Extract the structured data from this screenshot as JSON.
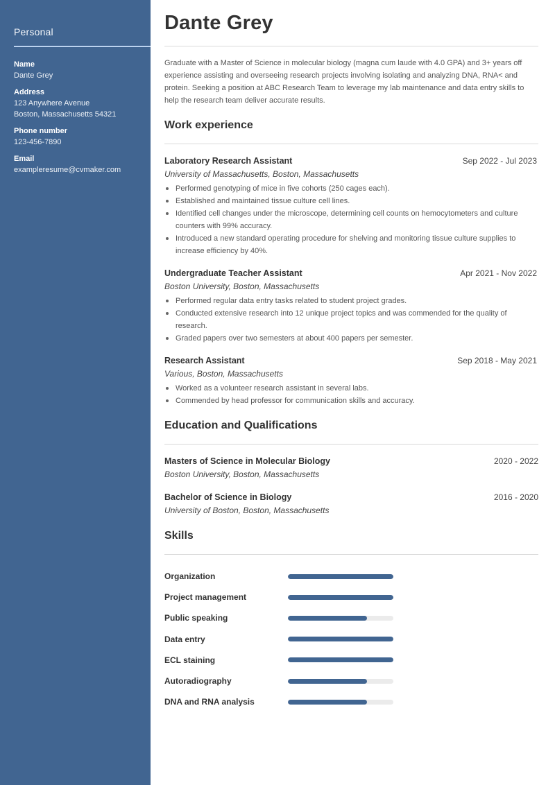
{
  "sidebar": {
    "title": "Personal",
    "fields": [
      {
        "label": "Name",
        "lines": [
          "Dante Grey"
        ]
      },
      {
        "label": "Address",
        "lines": [
          "123 Anywhere Avenue",
          "Boston, Massachusetts 54321"
        ]
      },
      {
        "label": "Phone number",
        "lines": [
          "123-456-7890"
        ]
      },
      {
        "label": "Email",
        "lines": [
          "exampleresume@cvmaker.com"
        ]
      }
    ]
  },
  "header": {
    "name": "Dante Grey",
    "summary": "Graduate with a Master of Science in molecular biology (magna cum laude with 4.0 GPA) and 3+ years off experience assisting and overseeing research projects involving isolating and analyzing DNA, RNA< and protein. Seeking a position at ABC Research Team to leverage my lab maintenance and data entry skills to help the research team deliver accurate results."
  },
  "work": {
    "title": "Work experience",
    "jobs": [
      {
        "title": "Laboratory Research Assistant",
        "dates": "Sep 2022 - Jul 2023",
        "place": "University of Massachusetts, Boston, Massachusetts",
        "bullets": [
          "Performed genotyping of mice in five cohorts (250 cages each).",
          "Established and maintained tissue culture cell lines.",
          "Identified cell changes under the microscope, determining cell counts on hemocytometers and culture counters with 99% accuracy.",
          "Introduced a new standard operating procedure for shelving and monitoring tissue culture supplies to increase efficiency by 40%."
        ]
      },
      {
        "title": "Undergraduate Teacher Assistant",
        "dates": "Apr 2021 - Nov 2022",
        "place": "Boston University, Boston, Massachusetts",
        "bullets": [
          "Performed regular data entry tasks related to student project grades.",
          "Conducted extensive research into 12 unique project topics and was commended for the quality of research.",
          "Graded papers over two semesters at about 400 papers per semester."
        ]
      },
      {
        "title": "Research Assistant",
        "dates": "Sep 2018 - May 2021",
        "place": "Various, Boston, Massachusetts",
        "bullets": [
          "Worked as a volunteer research assistant in several labs.",
          "Commended by head professor for communication skills and accuracy."
        ]
      }
    ]
  },
  "education": {
    "title": "Education and Qualifications",
    "items": [
      {
        "degree": "Masters of Science in Molecular Biology",
        "dates": "2020 - 2022",
        "place": "Boston University, Boston, Massachusetts"
      },
      {
        "degree": "Bachelor of Science in Biology",
        "dates": "2016 - 2020",
        "place": "University of Boston, Boston, Massachusetts"
      }
    ]
  },
  "skills": {
    "title": "Skills",
    "accent_color": "#416591",
    "track_color": "#ebebeb",
    "items": [
      {
        "name": "Organization",
        "level": 1.0
      },
      {
        "name": "Project management",
        "level": 1.0
      },
      {
        "name": "Public speaking",
        "level": 0.75
      },
      {
        "name": "Data entry",
        "level": 1.0
      },
      {
        "name": "ECL staining",
        "level": 1.0
      },
      {
        "name": "Autoradiography",
        "level": 0.75
      },
      {
        "name": "DNA and RNA analysis",
        "level": 0.75
      }
    ]
  }
}
